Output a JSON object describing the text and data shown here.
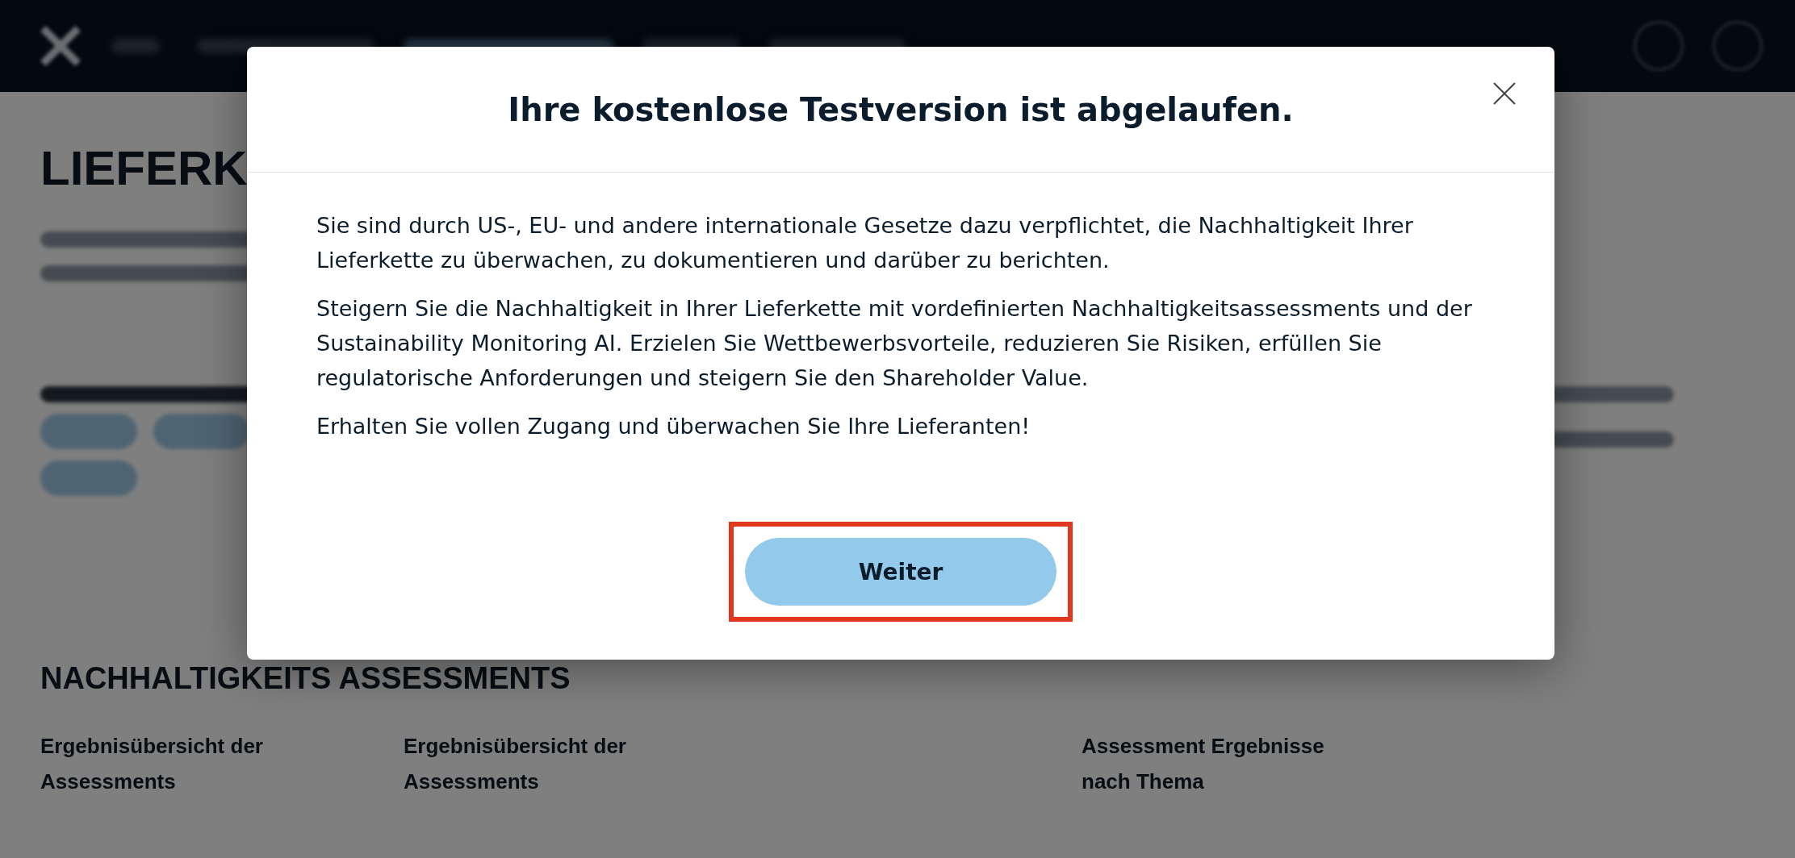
{
  "page": {
    "heading": "LIEFERK",
    "section_title": "NACHHALTIGKEITS ASSESSMENTS",
    "columns": [
      "Ergebnisübersicht der Assessments",
      "Ergebnisübersicht der Assessments",
      "Assessment Ergebnisse nach Thema"
    ]
  },
  "dialog": {
    "title": "Ihre kostenlose Testversion ist abgelaufen.",
    "paragraphs": [
      "Sie sind durch US-, EU- und andere internationale Gesetze dazu verpflichtet, die Nachhaltigkeit Ihrer Lieferkette zu überwachen, zu dokumentieren und darüber zu berichten.",
      "Steigern Sie die Nachhaltigkeit in Ihrer Lieferkette mit vordefinierten Nachhaltigkeitsassessments und der Sustainability Monitoring AI. Erzielen Sie Wettbewerbsvorteile, reduzieren Sie Risiken, erfüllen Sie regulatorische Anforderungen und steigern Sie den Shareholder Value.",
      "Erhalten Sie vollen Zugang und überwachen Sie Ihre Lieferanten!"
    ],
    "button": {
      "label": "Weiter",
      "highlighted": true
    }
  }
}
